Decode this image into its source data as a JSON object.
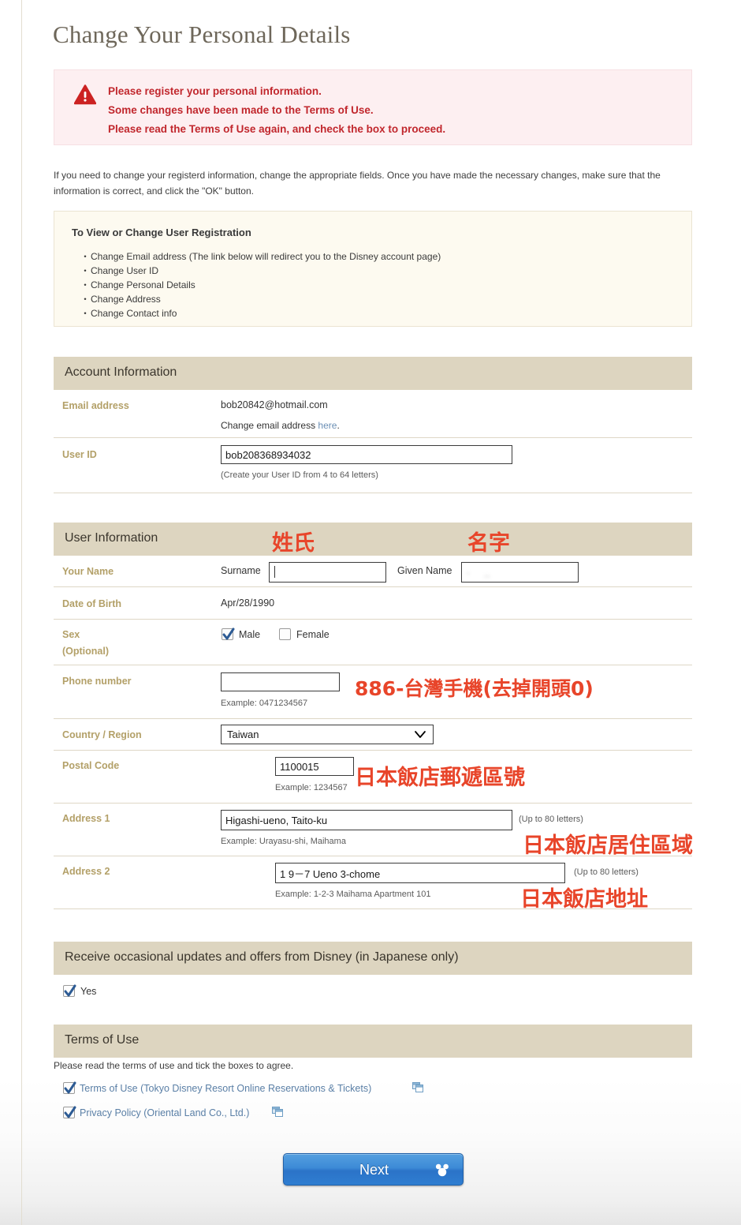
{
  "page": {
    "title": "Change Your Personal Details"
  },
  "alert": {
    "icon": "warning-triangle-icon",
    "lines": [
      "Please register your personal information.",
      "Some changes have been made to the Terms of Use.",
      "Please read the Terms of Use again, and check the box to proceed."
    ],
    "color": "#c1272d",
    "background": "#fdeff1"
  },
  "intro": "If you need to change your registerd information, change the appropriate fields. Once you have made the necessary changes, make sure that the information is correct, and click the \"OK\" button.",
  "info_box": {
    "title": "To View or Change User Registration",
    "items": [
      "Change Email address (The link below will redirect you to the Disney account page)",
      "Change User ID",
      "Change Personal Details",
      "Change Address",
      "Change Contact info"
    ]
  },
  "account_section": {
    "header": "Account Information",
    "email": {
      "label": "Email address",
      "value": "bob20842@hotmail.com",
      "change_prefix": "Change email address ",
      "change_link": "here",
      "change_suffix": "."
    },
    "user_id": {
      "label": "User ID",
      "value": "bob208368934032",
      "hint": "(Create your User ID from 4 to 64 letters)"
    }
  },
  "user_section": {
    "header": "User Information",
    "name": {
      "label": "Your Name",
      "surname_label": "Surname",
      "surname_value": "",
      "given_label": "Given Name",
      "given_value": ""
    },
    "dob": {
      "label": "Date of Birth",
      "value": "Apr/28/1990"
    },
    "sex": {
      "label": "Sex",
      "label_optional": "(Optional)",
      "male_label": "Male",
      "male_checked": true,
      "female_label": "Female",
      "female_checked": false
    },
    "phone": {
      "label": "Phone number",
      "value": "",
      "hint": "Example: 0471234567"
    },
    "country": {
      "label": "Country / Region",
      "selected": "Taiwan"
    },
    "postal": {
      "label": "Postal Code",
      "value": "1100015",
      "hint": "Example: 1234567"
    },
    "address1": {
      "label": "Address 1",
      "value": "Higashi-ueno, Taito-ku",
      "limit": "(Up to 80 letters)",
      "hint": "Example: Urayasu-shi, Maihama"
    },
    "address2": {
      "label": "Address 2",
      "value": "1 9－7 Ueno 3-chome",
      "limit": "(Up to 80 letters)",
      "hint": "Example: 1-2-3 Maihama Apartment 101"
    }
  },
  "updates_section": {
    "header": "Receive occasional updates and offers from Disney (in Japanese only)",
    "yes_label": "Yes",
    "yes_checked": true
  },
  "terms_section": {
    "header": "Terms of Use",
    "note": "Please read the terms of use and tick the boxes to agree.",
    "items": [
      {
        "label": "Terms of Use (Tokyo Disney Resort Online Reservations & Tickets)",
        "checked": true,
        "icon": "new-window-icon"
      },
      {
        "label": "Privacy Policy (Oriental Land Co., Ltd.)",
        "checked": true,
        "icon": "new-window-icon"
      }
    ]
  },
  "annotations": {
    "color": "#e8452a",
    "surname": "姓氏",
    "given_name": "名字",
    "phone": "886-台灣手機(去掉開頭0)",
    "postal": "日本飯店郵遞區號",
    "address1": "日本飯店居住區域",
    "address2": "日本飯店地址"
  },
  "footer": {
    "next_label": "Next",
    "next_icon": "mickey-icon",
    "next_color": "#2f7ed1"
  }
}
